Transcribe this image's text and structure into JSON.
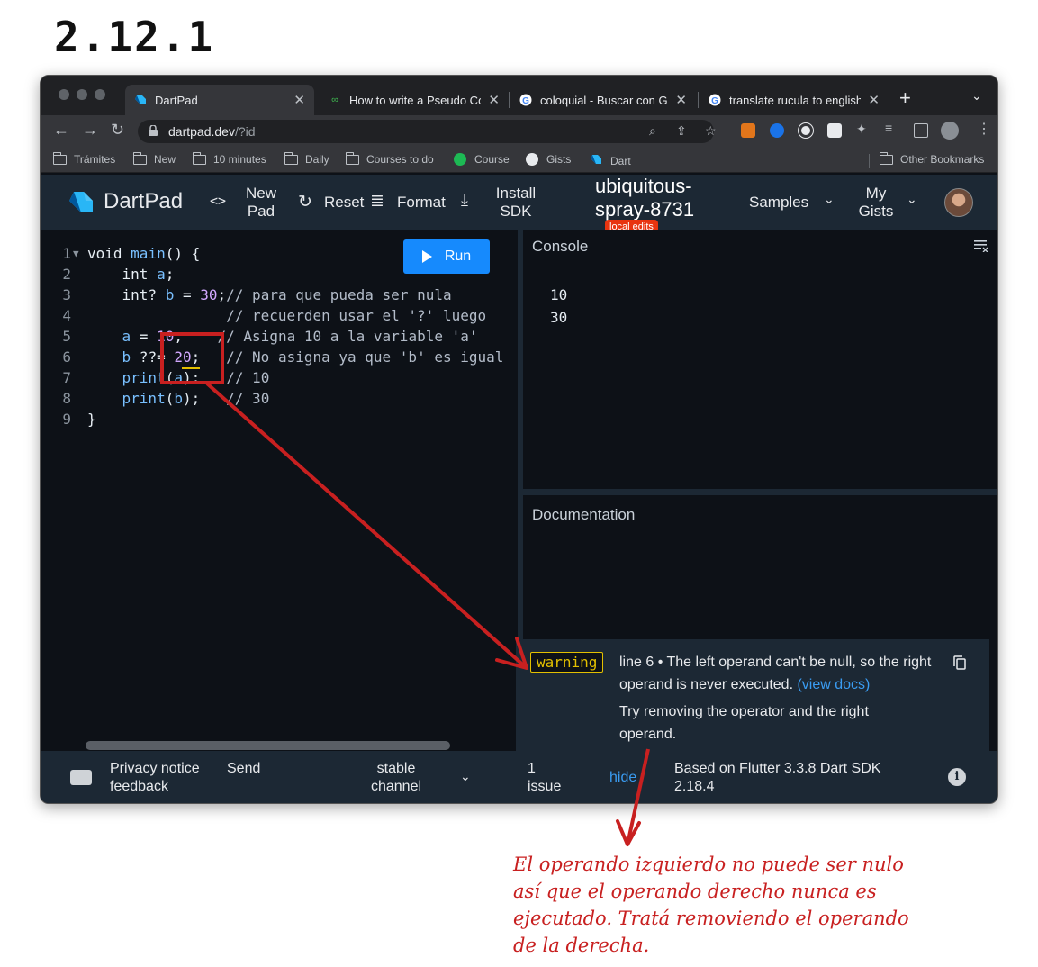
{
  "heading": "2.12.1",
  "browser": {
    "tabs": [
      {
        "label": "DartPad",
        "active": true
      },
      {
        "label": "How to write a Pseudo Co",
        "active": false
      },
      {
        "label": "coloquial - Buscar con Go",
        "active": false
      },
      {
        "label": "translate rucula to english",
        "active": false
      }
    ],
    "url_host": "dartpad.dev",
    "url_path": "/?id",
    "bookmarks": [
      "Trámites",
      "New",
      "10 minutes",
      "Daily",
      "Courses to do",
      "Course",
      "Gists",
      "Dart"
    ],
    "other_bookmarks": "Other Bookmarks"
  },
  "dartpad": {
    "app_name": "DartPad",
    "new_pad": [
      "New",
      "Pad"
    ],
    "reset": "Reset",
    "format": "Format",
    "install_sdk": [
      "Install",
      "SDK"
    ],
    "pad_name": [
      "ubiquitous-",
      "spray-8731"
    ],
    "local_edits": "local edits",
    "samples": "Samples",
    "my_gists": [
      "My",
      "Gists"
    ],
    "run": "Run"
  },
  "code": [
    {
      "n": "1",
      "fold": true,
      "parts": [
        [
          "kw",
          "void "
        ],
        [
          "fn",
          "main"
        ],
        [
          "op",
          "() {"
        ]
      ]
    },
    {
      "n": "2",
      "parts": [
        [
          "op",
          "    "
        ],
        [
          "kw",
          "int "
        ],
        [
          "fn",
          "a"
        ],
        [
          "op",
          ";"
        ]
      ]
    },
    {
      "n": "3",
      "parts": [
        [
          "op",
          "    "
        ],
        [
          "kw",
          "int? "
        ],
        [
          "fn",
          "b"
        ],
        [
          "op",
          " = "
        ],
        [
          "num",
          "30"
        ],
        [
          "op",
          ";"
        ],
        [
          "cm",
          "// para que pueda ser nula"
        ]
      ]
    },
    {
      "n": "4",
      "parts": [
        [
          "op",
          "                "
        ],
        [
          "cm",
          "// recuerden usar el '?' luego"
        ]
      ]
    },
    {
      "n": "5",
      "parts": [
        [
          "op",
          "    "
        ],
        [
          "fn",
          "a"
        ],
        [
          "op",
          " = "
        ],
        [
          "num",
          "10"
        ],
        [
          "op",
          ";    "
        ],
        [
          "cm",
          "// Asigna 10 a la variable 'a'"
        ]
      ]
    },
    {
      "n": "6",
      "parts": [
        [
          "op",
          "    "
        ],
        [
          "fn",
          "b"
        ],
        [
          "op",
          " ??= "
        ],
        [
          "num",
          "20"
        ],
        [
          "op",
          ";   "
        ],
        [
          "cm",
          "// No asigna ya que 'b' es igual"
        ]
      ]
    },
    {
      "n": "7",
      "parts": [
        [
          "op",
          "    "
        ],
        [
          "fn",
          "print"
        ],
        [
          "op",
          "("
        ],
        [
          "fn",
          "a"
        ],
        [
          "op",
          ");   "
        ],
        [
          "cm",
          "// 10"
        ]
      ]
    },
    {
      "n": "8",
      "parts": [
        [
          "op",
          "    "
        ],
        [
          "fn",
          "print"
        ],
        [
          "op",
          "("
        ],
        [
          "fn",
          "b"
        ],
        [
          "op",
          ");   "
        ],
        [
          "cm",
          "// 30"
        ]
      ]
    },
    {
      "n": "9",
      "parts": [
        [
          "op",
          "}"
        ]
      ]
    }
  ],
  "console": {
    "title": "Console",
    "output": [
      "10",
      "30"
    ]
  },
  "documentation": {
    "title": "Documentation"
  },
  "issue": {
    "severity": "warning",
    "message": "line 6 • The left operand can't be null, so the right operand is never executed.",
    "docs_link": "(view docs)",
    "fix": "Try removing the operator and the right operand."
  },
  "status": {
    "privacy": [
      "Privacy notice",
      "feedback"
    ],
    "send": "Send",
    "channel": [
      "stable",
      "channel"
    ],
    "issues_count": [
      "1",
      "issue"
    ],
    "hide": "hide",
    "flutter": [
      "Based on Flutter 3.3.8 Dart SDK",
      "2.18.4"
    ]
  },
  "annotation": {
    "note_lines": [
      "El operando izquierdo no puede ser nulo",
      "así que el operando derecho nunca es",
      "ejecutado. Tratá removiendo el operando",
      "de la derecha."
    ],
    "color": "#c82020"
  }
}
